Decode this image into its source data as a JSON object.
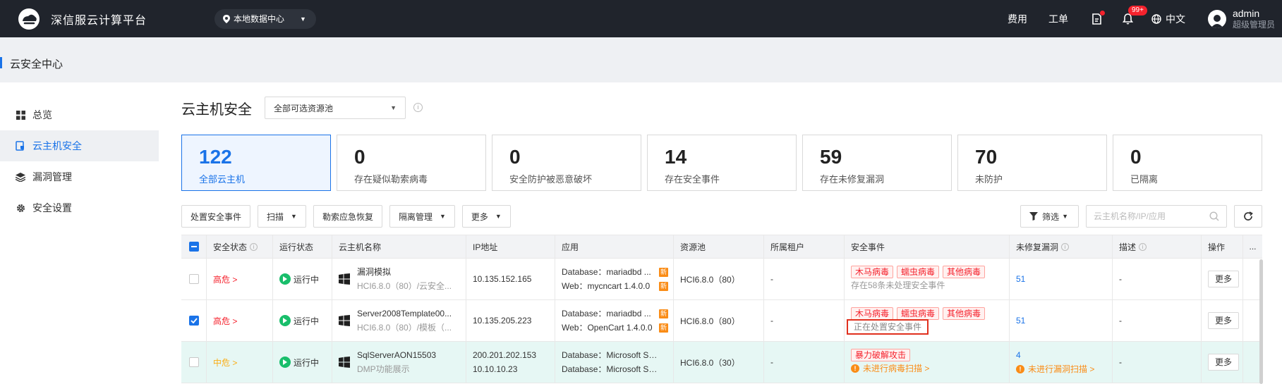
{
  "topbar": {
    "app_title": "深信服云计算平台",
    "datacenter": "本地数据中心",
    "links": [
      "费用",
      "工单"
    ],
    "notification_count": "99+",
    "language": "中文",
    "user_name": "admin",
    "user_role": "超级管理员"
  },
  "page": {
    "title": "云安全中心"
  },
  "sidebar": {
    "items": [
      {
        "label": "总览",
        "icon": "grid-icon"
      },
      {
        "label": "云主机安全",
        "icon": "host-security-icon",
        "active": true
      },
      {
        "label": "漏洞管理",
        "icon": "layers-icon"
      },
      {
        "label": "安全设置",
        "icon": "gear-icon"
      }
    ]
  },
  "main": {
    "title": "云主机安全",
    "pool_select": "全部可选资源池",
    "stats": [
      {
        "num": "122",
        "label": "全部云主机"
      },
      {
        "num": "0",
        "label": "存在疑似勒索病毒"
      },
      {
        "num": "0",
        "label": "安全防护被恶意破坏"
      },
      {
        "num": "14",
        "label": "存在安全事件"
      },
      {
        "num": "59",
        "label": "存在未修复漏洞"
      },
      {
        "num": "70",
        "label": "未防护"
      },
      {
        "num": "0",
        "label": "已隔离"
      }
    ],
    "toolbar": {
      "handle": "处置安全事件",
      "scan": "扫描",
      "recover": "勒索应急恢复",
      "isolate": "隔离管理",
      "more": "更多",
      "filter": "筛选",
      "search_placeholder": "云主机名称/IP/应用"
    }
  },
  "table": {
    "headers": [
      "安全状态",
      "运行状态",
      "云主机名称",
      "IP地址",
      "应用",
      "资源池",
      "所属租户",
      "安全事件",
      "未修复漏洞",
      "描述",
      "操作",
      "..."
    ],
    "rows": [
      {
        "risk": "高危 >",
        "run": "运行中",
        "name": "漏洞模拟",
        "name_sub": "HCI6.8.0（80）/云安全...",
        "ip1": "10.135.152.165",
        "ip2": "",
        "app1": "Database：mariadbd ...",
        "app2": "Web：mycncart 1.4.0.0",
        "new_tag": "新",
        "pool": "HCI6.8.0（80）",
        "tenant": "-",
        "tags": [
          "木马病毒",
          "蠕虫病毒",
          "其他病毒"
        ],
        "event_sub": "存在58条未处理安全事件",
        "vuln": "51",
        "vuln_sub": "",
        "desc": "-",
        "op": "更多"
      },
      {
        "risk": "高危 >",
        "run": "运行中",
        "name": "Server2008Template00...",
        "name_sub": "HCI6.8.0（80）/模板（...",
        "ip1": "10.135.205.223",
        "ip2": "",
        "app1": "Database：mariadbd ...",
        "app2": "Web：OpenCart 1.4.0.0",
        "new_tag": "新",
        "pool": "HCI6.8.0（80）",
        "tenant": "-",
        "tags": [
          "木马病毒",
          "蠕虫病毒",
          "其他病毒"
        ],
        "event_sub": "正在处置安全事件",
        "vuln": "51",
        "vuln_sub": "",
        "desc": "-",
        "op": "更多"
      },
      {
        "risk": "中危 >",
        "run": "运行中",
        "name": "SqlServerAON15503",
        "name_sub": "DMP功能展示",
        "ip1": "200.201.202.153",
        "ip2": "10.10.10.23",
        "app1": "Database：Microsoft SQ...",
        "app2": "Database：Microsoft SQ...",
        "new_tag": "",
        "pool": "HCI6.8.0（30）",
        "tenant": "-",
        "tags": [
          "暴力破解攻击"
        ],
        "event_sub": "未进行病毒扫描 >",
        "vuln": "4",
        "vuln_sub": "未进行漏洞扫描 >",
        "desc": "-",
        "op": "更多"
      }
    ]
  }
}
